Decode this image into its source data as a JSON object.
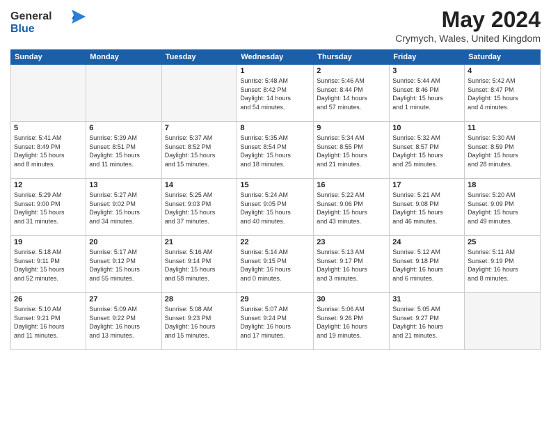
{
  "header": {
    "logo_line1": "General",
    "logo_line2": "Blue",
    "month_year": "May 2024",
    "location": "Crymych, Wales, United Kingdom"
  },
  "weekdays": [
    "Sunday",
    "Monday",
    "Tuesday",
    "Wednesday",
    "Thursday",
    "Friday",
    "Saturday"
  ],
  "weeks": [
    [
      {
        "day": "",
        "info": ""
      },
      {
        "day": "",
        "info": ""
      },
      {
        "day": "",
        "info": ""
      },
      {
        "day": "1",
        "info": "Sunrise: 5:48 AM\nSunset: 8:42 PM\nDaylight: 14 hours\nand 54 minutes."
      },
      {
        "day": "2",
        "info": "Sunrise: 5:46 AM\nSunset: 8:44 PM\nDaylight: 14 hours\nand 57 minutes."
      },
      {
        "day": "3",
        "info": "Sunrise: 5:44 AM\nSunset: 8:46 PM\nDaylight: 15 hours\nand 1 minute."
      },
      {
        "day": "4",
        "info": "Sunrise: 5:42 AM\nSunset: 8:47 PM\nDaylight: 15 hours\nand 4 minutes."
      }
    ],
    [
      {
        "day": "5",
        "info": "Sunrise: 5:41 AM\nSunset: 8:49 PM\nDaylight: 15 hours\nand 8 minutes."
      },
      {
        "day": "6",
        "info": "Sunrise: 5:39 AM\nSunset: 8:51 PM\nDaylight: 15 hours\nand 11 minutes."
      },
      {
        "day": "7",
        "info": "Sunrise: 5:37 AM\nSunset: 8:52 PM\nDaylight: 15 hours\nand 15 minutes."
      },
      {
        "day": "8",
        "info": "Sunrise: 5:35 AM\nSunset: 8:54 PM\nDaylight: 15 hours\nand 18 minutes."
      },
      {
        "day": "9",
        "info": "Sunrise: 5:34 AM\nSunset: 8:55 PM\nDaylight: 15 hours\nand 21 minutes."
      },
      {
        "day": "10",
        "info": "Sunrise: 5:32 AM\nSunset: 8:57 PM\nDaylight: 15 hours\nand 25 minutes."
      },
      {
        "day": "11",
        "info": "Sunrise: 5:30 AM\nSunset: 8:59 PM\nDaylight: 15 hours\nand 28 minutes."
      }
    ],
    [
      {
        "day": "12",
        "info": "Sunrise: 5:29 AM\nSunset: 9:00 PM\nDaylight: 15 hours\nand 31 minutes."
      },
      {
        "day": "13",
        "info": "Sunrise: 5:27 AM\nSunset: 9:02 PM\nDaylight: 15 hours\nand 34 minutes."
      },
      {
        "day": "14",
        "info": "Sunrise: 5:25 AM\nSunset: 9:03 PM\nDaylight: 15 hours\nand 37 minutes."
      },
      {
        "day": "15",
        "info": "Sunrise: 5:24 AM\nSunset: 9:05 PM\nDaylight: 15 hours\nand 40 minutes."
      },
      {
        "day": "16",
        "info": "Sunrise: 5:22 AM\nSunset: 9:06 PM\nDaylight: 15 hours\nand 43 minutes."
      },
      {
        "day": "17",
        "info": "Sunrise: 5:21 AM\nSunset: 9:08 PM\nDaylight: 15 hours\nand 46 minutes."
      },
      {
        "day": "18",
        "info": "Sunrise: 5:20 AM\nSunset: 9:09 PM\nDaylight: 15 hours\nand 49 minutes."
      }
    ],
    [
      {
        "day": "19",
        "info": "Sunrise: 5:18 AM\nSunset: 9:11 PM\nDaylight: 15 hours\nand 52 minutes."
      },
      {
        "day": "20",
        "info": "Sunrise: 5:17 AM\nSunset: 9:12 PM\nDaylight: 15 hours\nand 55 minutes."
      },
      {
        "day": "21",
        "info": "Sunrise: 5:16 AM\nSunset: 9:14 PM\nDaylight: 15 hours\nand 58 minutes."
      },
      {
        "day": "22",
        "info": "Sunrise: 5:14 AM\nSunset: 9:15 PM\nDaylight: 16 hours\nand 0 minutes."
      },
      {
        "day": "23",
        "info": "Sunrise: 5:13 AM\nSunset: 9:17 PM\nDaylight: 16 hours\nand 3 minutes."
      },
      {
        "day": "24",
        "info": "Sunrise: 5:12 AM\nSunset: 9:18 PM\nDaylight: 16 hours\nand 6 minutes."
      },
      {
        "day": "25",
        "info": "Sunrise: 5:11 AM\nSunset: 9:19 PM\nDaylight: 16 hours\nand 8 minutes."
      }
    ],
    [
      {
        "day": "26",
        "info": "Sunrise: 5:10 AM\nSunset: 9:21 PM\nDaylight: 16 hours\nand 11 minutes."
      },
      {
        "day": "27",
        "info": "Sunrise: 5:09 AM\nSunset: 9:22 PM\nDaylight: 16 hours\nand 13 minutes."
      },
      {
        "day": "28",
        "info": "Sunrise: 5:08 AM\nSunset: 9:23 PM\nDaylight: 16 hours\nand 15 minutes."
      },
      {
        "day": "29",
        "info": "Sunrise: 5:07 AM\nSunset: 9:24 PM\nDaylight: 16 hours\nand 17 minutes."
      },
      {
        "day": "30",
        "info": "Sunrise: 5:06 AM\nSunset: 9:26 PM\nDaylight: 16 hours\nand 19 minutes."
      },
      {
        "day": "31",
        "info": "Sunrise: 5:05 AM\nSunset: 9:27 PM\nDaylight: 16 hours\nand 21 minutes."
      },
      {
        "day": "",
        "info": ""
      }
    ]
  ]
}
